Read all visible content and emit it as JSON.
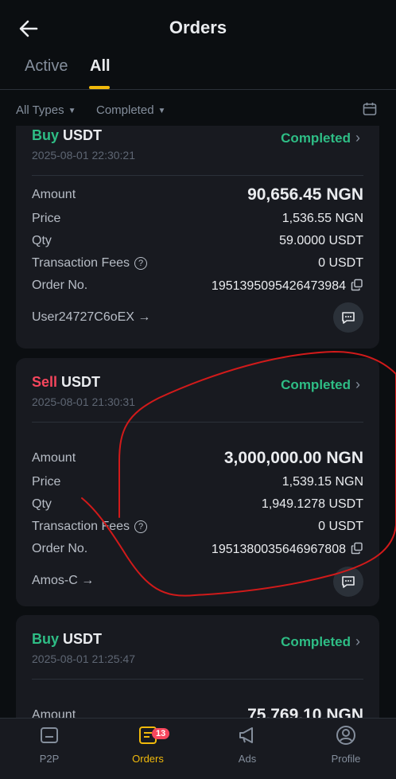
{
  "header": {
    "title": "Orders"
  },
  "tabs": [
    {
      "label": "Active"
    },
    {
      "label": "All"
    }
  ],
  "filters": {
    "type": "All Types",
    "status": "Completed"
  },
  "orders": [
    {
      "side": "Buy",
      "asset": "USDT",
      "time": "2025-08-01 22:30:21",
      "status": "Completed",
      "amount_label": "Amount",
      "amount": "90,656.45 NGN",
      "price_label": "Price",
      "price": "1,536.55 NGN",
      "qty_label": "Qty",
      "qty": "59.0000 USDT",
      "fees_label": "Transaction Fees",
      "fees": "0 USDT",
      "order_label": "Order No.",
      "order_no": "1951395095426473984",
      "counterparty": "User24727C6oEX"
    },
    {
      "side": "Sell",
      "asset": "USDT",
      "time": "2025-08-01 21:30:31",
      "status": "Completed",
      "amount_label": "Amount",
      "amount": "3,000,000.00 NGN",
      "price_label": "Price",
      "price": "1,539.15 NGN",
      "qty_label": "Qty",
      "qty": "1,949.1278 USDT",
      "fees_label": "Transaction Fees",
      "fees": "0 USDT",
      "order_label": "Order No.",
      "order_no": "1951380035646967808",
      "counterparty": "Amos-C"
    },
    {
      "side": "Buy",
      "asset": "USDT",
      "time": "2025-08-01 21:25:47",
      "status": "Completed",
      "amount_label": "Amount",
      "amount": "75,769.10 NGN"
    }
  ],
  "bottom_nav": [
    {
      "label": "P2P"
    },
    {
      "label": "Orders",
      "badge": "13"
    },
    {
      "label": "Ads"
    },
    {
      "label": "Profile"
    }
  ],
  "colors": {
    "accent": "#f0b90b",
    "buy": "#2ebd85",
    "sell": "#f6465d",
    "annotation": "#d11a1a"
  }
}
